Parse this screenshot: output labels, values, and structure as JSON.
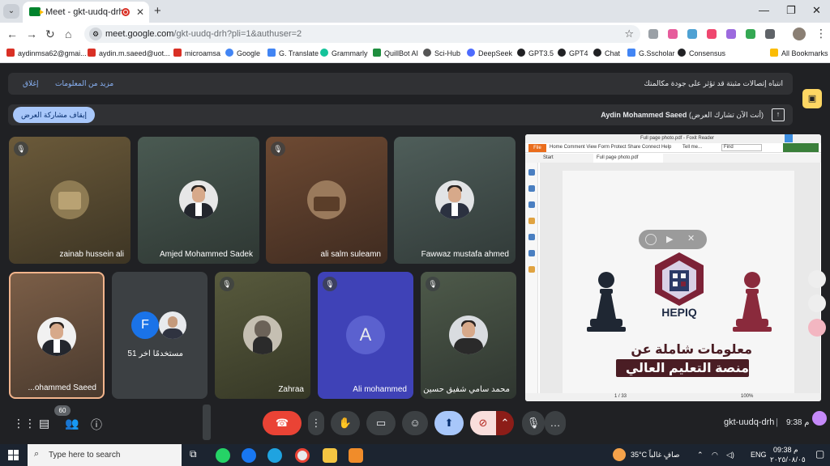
{
  "browser": {
    "tab_title": "Meet - gkt-uudq-drh",
    "tab_close": "✕",
    "new_tab": "+",
    "url_host": "meet.google.com",
    "url_path": "/gkt-uudq-drh?pli=1&authuser=2",
    "window_controls": [
      "—",
      "❐",
      "✕"
    ]
  },
  "bookmarks": [
    {
      "label": "aydinmsa62@gmai...",
      "color": "#d93025"
    },
    {
      "label": "aydin.m.saeed@uot...",
      "color": "#d93025"
    },
    {
      "label": "microamsa",
      "color": "#d93025"
    },
    {
      "label": "Google",
      "color": "#4285f4"
    },
    {
      "label": "G. Translate",
      "color": "#4285f4"
    },
    {
      "label": "Grammarly",
      "color": "#15c39a"
    },
    {
      "label": "QuillBot AI",
      "color": "#1e8e3e"
    },
    {
      "label": "Sci-Hub",
      "color": "#555555"
    },
    {
      "label": "DeepSeek",
      "color": "#4d6bfe"
    },
    {
      "label": "GPT3.5",
      "color": "#202124"
    },
    {
      "label": "GPT4",
      "color": "#202124"
    },
    {
      "label": "Chat",
      "color": "#202124"
    },
    {
      "label": "G.Sscholar",
      "color": "#4285f4"
    },
    {
      "label": "Consensus",
      "color": "#202124"
    }
  ],
  "all_bookmarks": "All Bookmarks",
  "banner": {
    "message": "انتباه إتصالات مثبتة قد تؤثر على جودة مكالمتك",
    "more_info": "مزيد من المعلومات",
    "dismiss": "إغلاق"
  },
  "presenting": {
    "stop_button": "إيقاف مشاركة العرض",
    "presenter": "Aydin Mohammed Saeed",
    "status": "(أنت الآن تشارك العرض)"
  },
  "participants": [
    {
      "name": "zainab hussein ali",
      "muted": true
    },
    {
      "name": "Amjed Mohammed Sadek",
      "muted": false
    },
    {
      "name": "ali salm suleamn",
      "muted": true
    },
    {
      "name": "Fawwaz mustafa ahmed",
      "muted": false
    },
    {
      "name": "...ohammed Saeed",
      "muted": false
    },
    {
      "name": "51 مستخدمًا آخر",
      "muted": false
    },
    {
      "name": "Zahraa",
      "muted": true
    },
    {
      "name": "Ali mohammed",
      "muted": true,
      "initial": "A"
    },
    {
      "name": "محمد سامي شفيق حسين",
      "muted": true
    }
  ],
  "others_tile": {
    "initial": "F"
  },
  "shared_screen": {
    "app_title": "Full page photo.pdf - Foxit Reader",
    "menu": "Home  Comment  View  Form  Protect  Share  Connect  Help",
    "file_tab": "File",
    "tell_me": "Tell me...",
    "find": "Find",
    "tabs": [
      "Start",
      "Full page photo.pdf"
    ],
    "page_indicator": "1 / 33",
    "zoom": "100%",
    "logo_text": "HEPIQ",
    "headline_1": "معلومات شاملة عن",
    "headline_2": "منصة التعليم العالي"
  },
  "controls": {
    "participants_badge": "60",
    "meeting_code": "gkt-uudq-drh",
    "time": "9:38 م"
  },
  "taskbar": {
    "search_placeholder": "Type here to search",
    "weather": "35°C  صافٍ غالباً",
    "language": "ENG",
    "clock_time": "09:38 م",
    "clock_date": "٢٠٢٥/٠٨/٠٥"
  },
  "colors": {
    "meet_bg": "#202124",
    "end_call": "#ea4335",
    "present_active": "#a8c7fa",
    "camera_off": "#f9dedc"
  }
}
